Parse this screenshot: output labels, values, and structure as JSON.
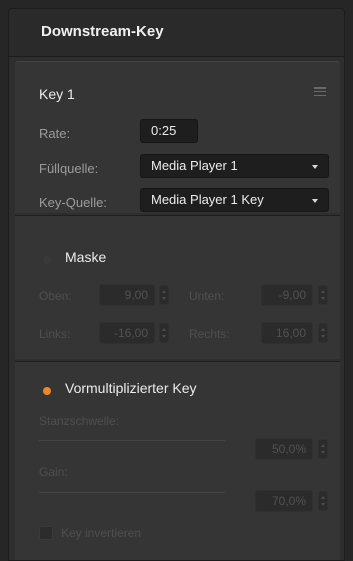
{
  "panel": {
    "title": "Downstream-Key"
  },
  "key": {
    "title": "Key 1",
    "rate_label": "Rate:",
    "rate_value": "0:25",
    "fill_source_label": "Füllquelle:",
    "fill_source_value": "Media Player 1",
    "key_source_label": "Key-Quelle:",
    "key_source_value": "Media Player 1 Key"
  },
  "mask": {
    "label": "Maske",
    "enabled_color": "#3a3a3a",
    "top_label": "Oben:",
    "top_value": "9,00",
    "bottom_label": "Unten:",
    "bottom_value": "-9,00",
    "left_label": "Links:",
    "left_value": "-16,00",
    "right_label": "Rechts:",
    "right_value": "16,00"
  },
  "premult": {
    "label": "Vormultiplizierter Key",
    "enabled_color": "#f0862b",
    "clip_label": "Stanzschwelle:",
    "clip_value": "50,0%",
    "gain_label": "Gain:",
    "gain_value": "70,0%",
    "invert_label": "Key invertieren"
  }
}
